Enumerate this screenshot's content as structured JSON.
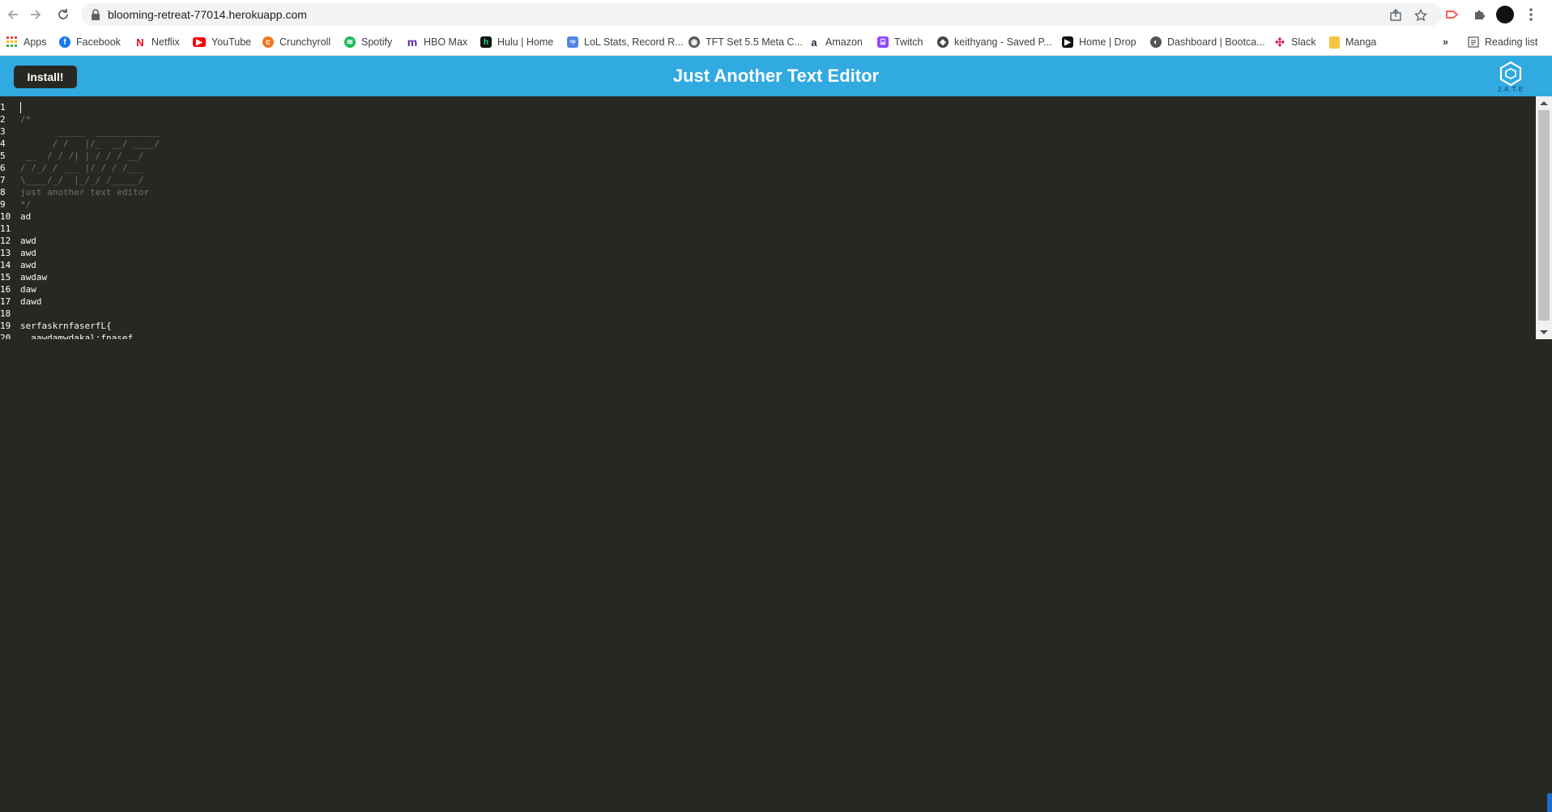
{
  "browser": {
    "url": "blooming-retreat-77014.herokuapp.com",
    "icons": {
      "back": "arrow-left-icon",
      "forward": "arrow-right-icon",
      "reload": "reload-icon",
      "lock": "lock-icon",
      "share": "share-icon",
      "bookmark": "star-icon",
      "extension": "puzzle-icon",
      "menu": "kebab-menu-icon"
    },
    "bookmarks": [
      {
        "label": "Apps",
        "icon": "apps-grid-icon",
        "color": "#ea4335"
      },
      {
        "label": "Facebook",
        "icon": "facebook-icon",
        "color": "#1877f2"
      },
      {
        "label": "Netflix",
        "icon": "netflix-icon",
        "color": "#e50914"
      },
      {
        "label": "YouTube",
        "icon": "youtube-icon",
        "color": "#ff0000"
      },
      {
        "label": "Crunchyroll",
        "icon": "crunchyroll-icon",
        "color": "#f47521"
      },
      {
        "label": "Spotify",
        "icon": "spotify-icon",
        "color": "#1db954"
      },
      {
        "label": "HBO Max",
        "icon": "hbo-max-icon",
        "color": "#5822b4"
      },
      {
        "label": "Hulu | Home",
        "icon": "hulu-icon",
        "color": "#1ce783"
      },
      {
        "label": "LoL Stats, Record R...",
        "icon": "opgg-icon",
        "color": "#5383e8"
      },
      {
        "label": "TFT Set 5.5 Meta C...",
        "icon": "tft-icon",
        "color": "#555555"
      },
      {
        "label": "Amazon",
        "icon": "amazon-icon",
        "color": "#232f3e"
      },
      {
        "label": "Twitch",
        "icon": "twitch-icon",
        "color": "#9146ff"
      },
      {
        "label": "keithyang - Saved P...",
        "icon": "github-icon",
        "color": "#444444"
      },
      {
        "label": "Home | Drop",
        "icon": "drop-icon",
        "color": "#111111"
      },
      {
        "label": "Dashboard | Bootca...",
        "icon": "bootcamp-icon",
        "color": "#555555"
      },
      {
        "label": "Slack",
        "icon": "slack-icon",
        "color": "#e01e5a"
      },
      {
        "label": "Manga",
        "icon": "folder-icon",
        "color": "#f5c542"
      }
    ],
    "overflow": "»",
    "reading_list": "Reading list"
  },
  "app": {
    "install_label": "Install!",
    "title": "Just Another Text Editor",
    "logo_text": "J.A.T.E",
    "header_color": "#31a9e1",
    "editor_bg": "#272822"
  },
  "editor": {
    "lines": [
      {
        "n": "1",
        "text": "",
        "kind": "plain"
      },
      {
        "n": "2",
        "text": "/*",
        "kind": "comment"
      },
      {
        "n": "3",
        "text": "       _____  ____________",
        "kind": "comment"
      },
      {
        "n": "4",
        "text": "      / /   |/_  __/ ____/",
        "kind": "comment"
      },
      {
        "n": "5",
        "text": " __  / / /| | / / / __/",
        "kind": "comment"
      },
      {
        "n": "6",
        "text": "/ /_/ / ___ |/ / / /___",
        "kind": "comment"
      },
      {
        "n": "7",
        "text": "\\____/_/  |_/_/ /_____/",
        "kind": "comment"
      },
      {
        "n": "8",
        "text": "just another text editor",
        "kind": "comment"
      },
      {
        "n": "9",
        "text": "*/",
        "kind": "comment"
      },
      {
        "n": "10",
        "text": "ad",
        "kind": "plain"
      },
      {
        "n": "11",
        "text": "",
        "kind": "plain"
      },
      {
        "n": "12",
        "text": "awd",
        "kind": "plain"
      },
      {
        "n": "13",
        "text": "awd",
        "kind": "plain"
      },
      {
        "n": "14",
        "text": "awd",
        "kind": "plain"
      },
      {
        "n": "15",
        "text": "awdaw",
        "kind": "plain"
      },
      {
        "n": "16",
        "text": "daw",
        "kind": "plain"
      },
      {
        "n": "17",
        "text": "dawd",
        "kind": "plain"
      },
      {
        "n": "18",
        "text": "",
        "kind": "plain"
      },
      {
        "n": "19",
        "text": "serfaskrnfaserfL{",
        "kind": "plain"
      },
      {
        "n": "20",
        "text": "  aawdamwdakal:fnasef",
        "kind": "plain"
      }
    ]
  }
}
